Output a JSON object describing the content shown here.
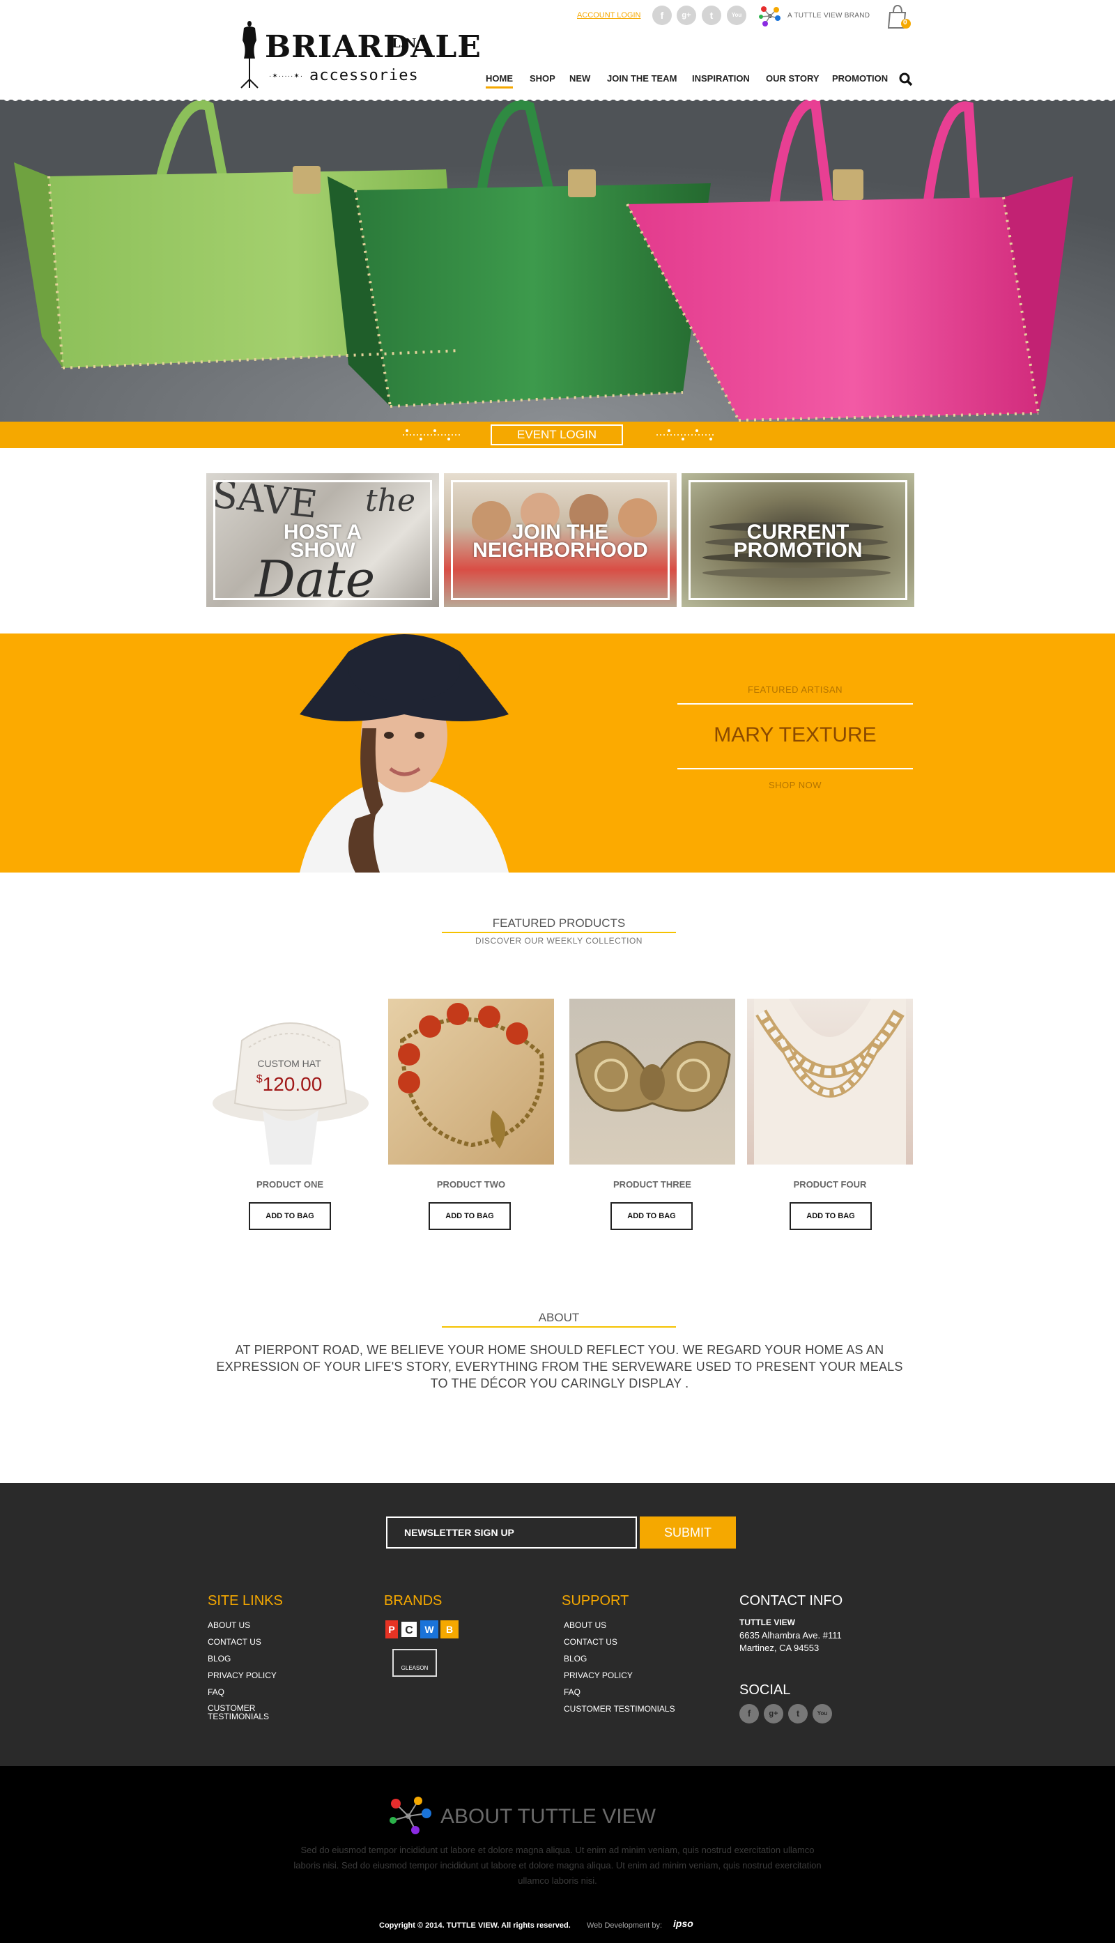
{
  "header": {
    "logo_title": "BRIARDALE",
    "logo_sup": "L.N.",
    "logo_sub": "accessories",
    "account_login": "ACCOUNT LOGIN",
    "social": [
      "f",
      "g+",
      "t",
      "You"
    ],
    "tuttle_brand": "A TUTTLE VIEW BRAND",
    "cart_count": "0"
  },
  "nav": {
    "items": [
      "HOME",
      "SHOP",
      "NEW",
      "JOIN THE TEAM",
      "INSPIRATION",
      "OUR STORY",
      "PROMOTION"
    ],
    "active": "HOME"
  },
  "hero": {
    "event_login": "EVENT LOGIN"
  },
  "tiles": [
    {
      "label": "HOST A\nSHOW"
    },
    {
      "label": "JOIN THE\nNEIGHBORHOOD"
    },
    {
      "label": "CURRENT\nPROMOTION"
    }
  ],
  "artisan": {
    "label": "FEATURED ARTISAN",
    "name": "MARY TEXTURE",
    "shop_now": "SHOP NOW"
  },
  "featured": {
    "title": "FEATURED PRODUCTS",
    "subtitle": "DISCOVER OUR WEEKLY COLLECTION",
    "custom_hat_label": "CUSTOM HAT",
    "custom_hat_currency": "$",
    "custom_hat_price": "120.00",
    "products": [
      {
        "name": "PRODUCT ONE",
        "button": "ADD TO BAG"
      },
      {
        "name": "PRODUCT TWO",
        "button": "ADD TO BAG"
      },
      {
        "name": "PRODUCT THREE",
        "button": "ADD TO BAG"
      },
      {
        "name": "PRODUCT FOUR",
        "button": "ADD TO BAG"
      }
    ]
  },
  "about": {
    "title": "ABOUT",
    "body": "AT PIERPONT ROAD, WE BELIEVE YOUR HOME SHOULD REFLECT  YOU. WE REGARD  YOUR HOME AS AN EXPRESSION OF YOUR LIFE'S STORY, EVERYTHING FROM THE SERVEWARE USED TO PRESENT YOUR MEALS TO THE DÉCOR YOU CARINGLY DISPLAY ."
  },
  "footer": {
    "newsletter_placeholder": "NEWSLETTER SIGN UP",
    "submit": "SUBMIT",
    "site_links_title": "SITE LINKS",
    "site_links": [
      "ABOUT US",
      "CONTACT US",
      "BLOG",
      "PRIVACY POLICY",
      "FAQ",
      "CUSTOMER\nTESTIMONIALS"
    ],
    "brands_title": "BRANDS",
    "brand_letters": [
      "P",
      "C",
      "W",
      "B"
    ],
    "brand_gleason": "GLEASON",
    "support_title": "SUPPORT",
    "support_links": [
      "ABOUT US",
      "CONTACT US",
      "BLOG",
      "PRIVACY POLICY",
      "FAQ",
      "CUSTOMER TESTIMONIALS"
    ],
    "contact_title": "CONTACT INFO",
    "contact_company": "TUTTLE VIEW",
    "contact_address1": "6635 Alhambra Ave. #111",
    "contact_address2": "Martinez, CA 94553",
    "social_title": "SOCIAL",
    "social": [
      "f",
      "g+",
      "t",
      "You"
    ]
  },
  "bottom": {
    "title": "ABOUT TUTTLE VIEW",
    "body": "Sed do eiusmod tempor incididunt ut labore et dolore magna aliqua. Ut enim ad minim veniam, quis nostrud exercitation ullamco laboris nisi. Sed do eiusmod tempor incididunt ut labore et dolore magna aliqua. Ut enim ad minim veniam, quis nostrud exercitation ullamco laboris nisi.",
    "copyright": "Copyright © 2014. TUTTLE VIEW. All rights reserved.",
    "webdev": "Web Development by:",
    "webdev_logo": "ipso"
  },
  "colors": {
    "accent": "#f5a800",
    "artisan_bg": "#fcaa00",
    "footer_bg": "#2a2a2a",
    "bottom_bg": "#000000"
  }
}
